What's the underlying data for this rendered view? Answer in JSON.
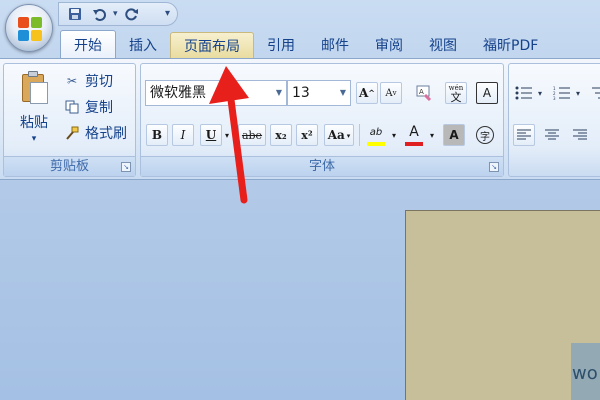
{
  "quick_access": {
    "save_icon": "save-icon",
    "undo_icon": "undo-icon",
    "repeat_icon": "repeat-icon"
  },
  "tabs": [
    {
      "label": "开始",
      "state": "active"
    },
    {
      "label": "插入",
      "state": "normal"
    },
    {
      "label": "页面布局",
      "state": "hover"
    },
    {
      "label": "引用",
      "state": "normal"
    },
    {
      "label": "邮件",
      "state": "normal"
    },
    {
      "label": "审阅",
      "state": "normal"
    },
    {
      "label": "视图",
      "state": "normal"
    },
    {
      "label": "福昕PDF",
      "state": "normal"
    }
  ],
  "clipboard": {
    "paste_label": "粘贴",
    "cut_label": "剪切",
    "copy_label": "复制",
    "format_painter_label": "格式刷",
    "group_label": "剪贴板"
  },
  "font": {
    "font_name": "微软雅黑",
    "font_size": "13",
    "group_label": "字体",
    "bold": "B",
    "italic": "I",
    "underline": "U",
    "strikethrough": "abe",
    "subscript": "x₂",
    "superscript": "x²",
    "change_case": "Aa",
    "grow_font": "A",
    "shrink_font": "A",
    "clear_format": "A",
    "phonetic": "wén",
    "char_border": "A",
    "highlight_label": "ab",
    "font_color_label": "A",
    "char_shading": "A",
    "enclose_char": "字",
    "highlight_color": "#ffff00",
    "font_color": "#e02020"
  },
  "document": {
    "visible_text": "wo"
  },
  "colors": {
    "annotation_arrow": "#e8201c",
    "page_background": "#c6bf99"
  }
}
